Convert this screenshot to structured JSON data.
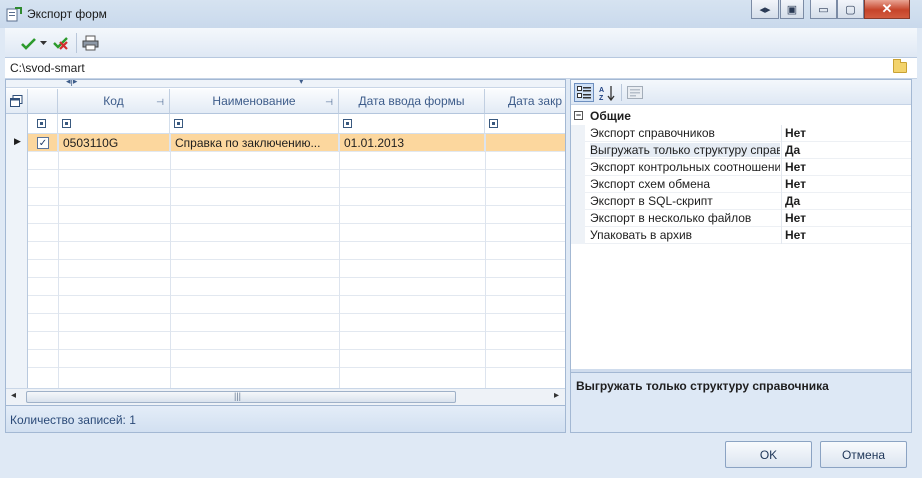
{
  "window": {
    "title": "Экспорт форм",
    "system_buttons": {
      "help": "◂▸",
      "copy": "▣",
      "minimize": "▭",
      "maximize": "▢",
      "close": "✕"
    }
  },
  "toolbar": {
    "icons": [
      "check-icon",
      "dropdown-arrow-icon",
      "uncheck-icon",
      "print-icon"
    ]
  },
  "path": {
    "value": "C:\\svod-smart"
  },
  "grid": {
    "columns": [
      {
        "label": "Код"
      },
      {
        "label": "Наименование"
      },
      {
        "label": "Дата ввода формы"
      },
      {
        "label": "Дата закр"
      }
    ],
    "rows": [
      {
        "checked": true,
        "code": "0503110G",
        "name": "Справка по заключению...",
        "date_in": "01.01.2013",
        "date_close": ""
      }
    ]
  },
  "status": {
    "records": "Количество записей: 1"
  },
  "properties": {
    "group": "Общие",
    "items": [
      {
        "name": "Экспорт справочников",
        "value": "Нет"
      },
      {
        "name": "Выгружать только структуру справочника",
        "value": "Да"
      },
      {
        "name": "Экспорт контрольных соотношений",
        "value": "Нет"
      },
      {
        "name": "Экспорт схем обмена",
        "value": "Нет"
      },
      {
        "name": "Экспорт в SQL-скрипт",
        "value": "Да"
      },
      {
        "name": "Экспорт в несколько файлов",
        "value": "Нет"
      },
      {
        "name": "Упаковать в архив",
        "value": "Нет"
      }
    ],
    "description": "Выгружать только структуру справочника"
  },
  "buttons": {
    "ok": "OK",
    "cancel": "Отмена"
  },
  "colors": {
    "selected_row": "#fcd79e",
    "header_text": "#3d5c8a",
    "close_button": "#c6442a"
  }
}
